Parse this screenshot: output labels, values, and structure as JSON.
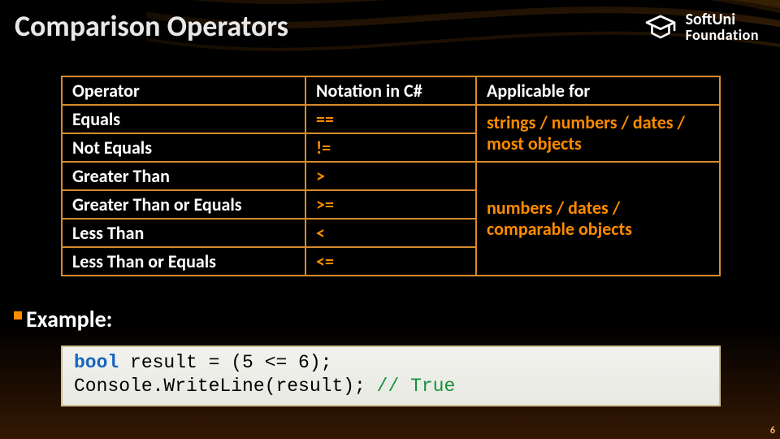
{
  "title": "Comparison Operators",
  "logo": {
    "line1": "SoftUni",
    "line2": "Foundation"
  },
  "table": {
    "headers": {
      "operator": "Operator",
      "notation": "Notation in C#",
      "applicable": "Applicable for"
    },
    "rows": [
      {
        "operator": "Equals",
        "notation": "=="
      },
      {
        "operator": "Not Equals",
        "notation": "!="
      },
      {
        "operator": "Greater Than",
        "notation": ">"
      },
      {
        "operator": "Greater Than or Equals",
        "notation": ">="
      },
      {
        "operator": "Less Than",
        "notation": "<"
      },
      {
        "operator": "Less Than or Equals",
        "notation": "<="
      }
    ],
    "applicable_group_1": "strings / numbers / dates / most objects",
    "applicable_group_2": "numbers / dates / comparable objects"
  },
  "example_label": "Example:",
  "code": {
    "kw_bool": "bool",
    "rest1": " result = (5 <= 6);",
    "line2a": "Console.WriteLine(result); ",
    "comment": "// True"
  },
  "page_number": "6"
}
